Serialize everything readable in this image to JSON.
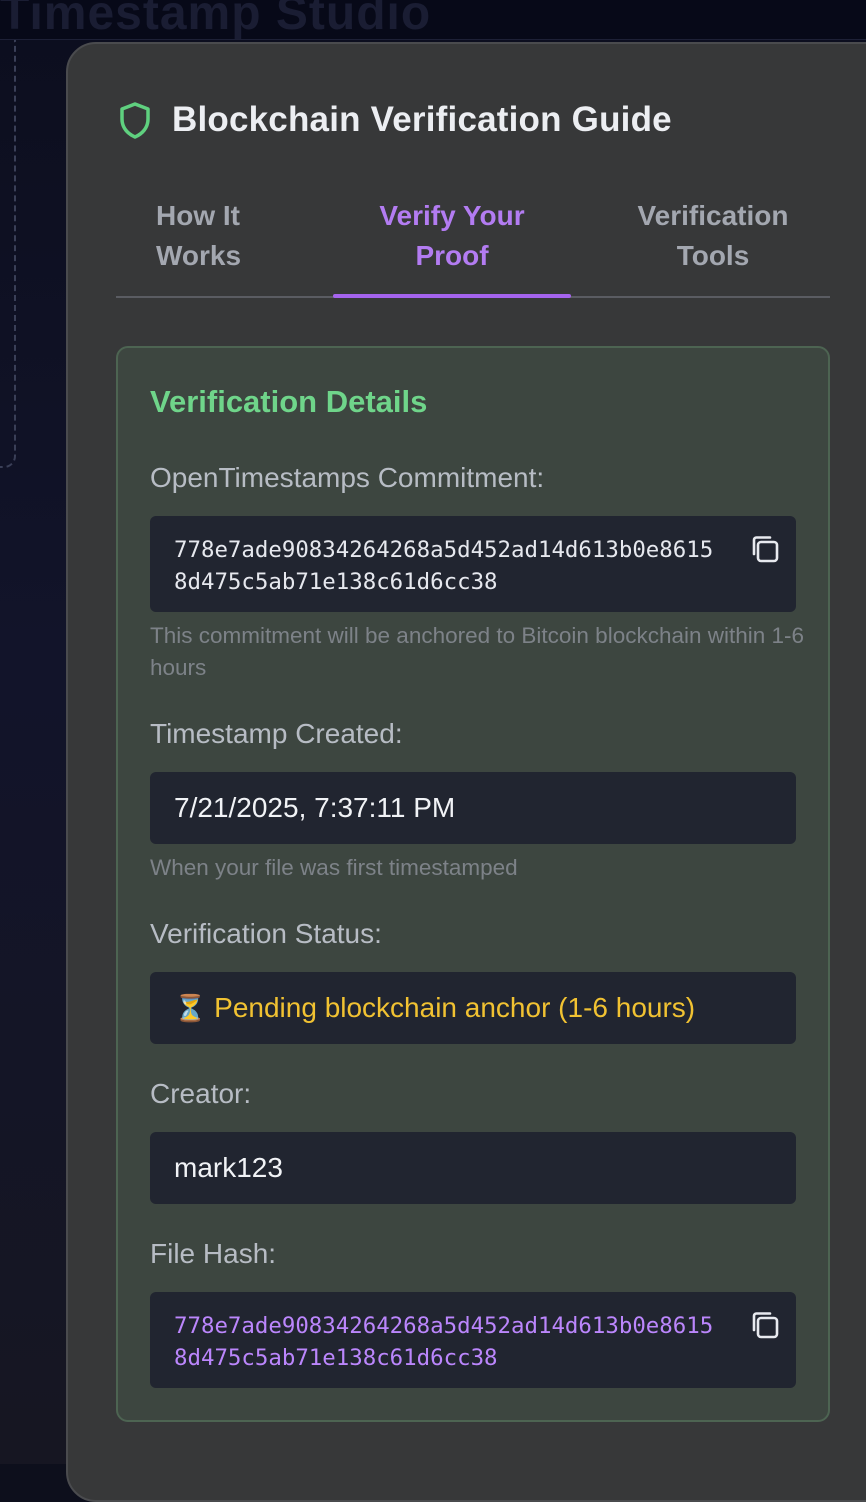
{
  "background": {
    "ghost_title": "Timestamp Studio"
  },
  "panel": {
    "title": "Blockchain Verification Guide",
    "shield_icon": "shield-icon",
    "accent_color": "#a564ee",
    "tabs": [
      {
        "label_line1": "How It",
        "label_line2": "Works",
        "active": false
      },
      {
        "label_line1": "Verify Your",
        "label_line2": "Proof",
        "active": true
      },
      {
        "label_line1": "Verification",
        "label_line2": "Tools",
        "active": false
      }
    ]
  },
  "details": {
    "title": "Verification Details",
    "commitment": {
      "label": "OpenTimestamps Commitment:",
      "value": "778e7ade90834264268a5d452ad14d613b0e86158d475c5ab71e138c61d6cc38",
      "hint": "This commitment will be anchored to Bitcoin blockchain within 1-6 hours",
      "copy_icon": "copy-icon"
    },
    "timestamp": {
      "label": "Timestamp Created:",
      "value": "7/21/2025, 7:37:11 PM",
      "hint": "When your file was first timestamped"
    },
    "status": {
      "label": "Verification Status:",
      "icon": "⏳",
      "value": "Pending blockchain anchor (1-6 hours)",
      "color": "#f1c232"
    },
    "creator": {
      "label": "Creator:",
      "value": "mark123"
    },
    "file_hash": {
      "label": "File Hash:",
      "value": "778e7ade90834264268a5d452ad14d613b0e86158d475c5ab71e138c61d6cc38",
      "copy_icon": "copy-icon"
    }
  }
}
